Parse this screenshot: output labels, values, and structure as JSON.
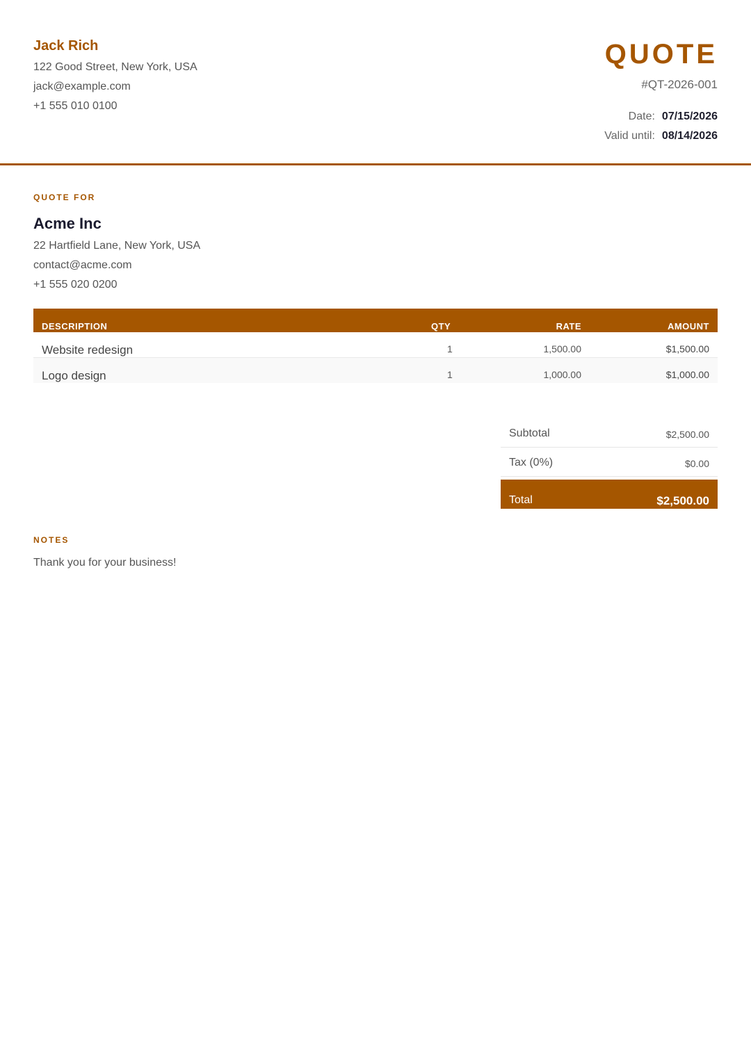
{
  "sender": {
    "name": "Jack Rich",
    "address": "122 Good Street, New York, USA",
    "email": "jack@example.com",
    "phone": "+1 555 010 0100"
  },
  "document": {
    "title": "QUOTE",
    "number": "#QT-2026-001",
    "date_label": "Date:",
    "date_value": "07/15/2026",
    "valid_label": "Valid until:",
    "valid_value": "08/14/2026"
  },
  "client": {
    "section_label": "QUOTE FOR",
    "name": "Acme Inc",
    "address": "22 Hartfield Lane, New York, USA",
    "email": "contact@acme.com",
    "phone": "+1 555 020 0200"
  },
  "items_table": {
    "headers": {
      "description": "DESCRIPTION",
      "qty": "QTY",
      "rate": "RATE",
      "amount": "AMOUNT"
    },
    "rows": [
      {
        "description": "Website redesign",
        "qty": "1",
        "rate": "1,500.00",
        "amount": "$1,500.00"
      },
      {
        "description": "Logo design",
        "qty": "1",
        "rate": "1,000.00",
        "amount": "$1,000.00"
      }
    ]
  },
  "totals": {
    "subtotal_label": "Subtotal",
    "subtotal_value": "$2,500.00",
    "tax_label": "Tax (0%)",
    "tax_value": "$0.00",
    "total_label": "Total",
    "total_value": "$2,500.00"
  },
  "notes": {
    "section_label": "NOTES",
    "text": "Thank you for your business!"
  },
  "colors": {
    "accent": "#a55600",
    "heading": "#1a1a2e"
  }
}
